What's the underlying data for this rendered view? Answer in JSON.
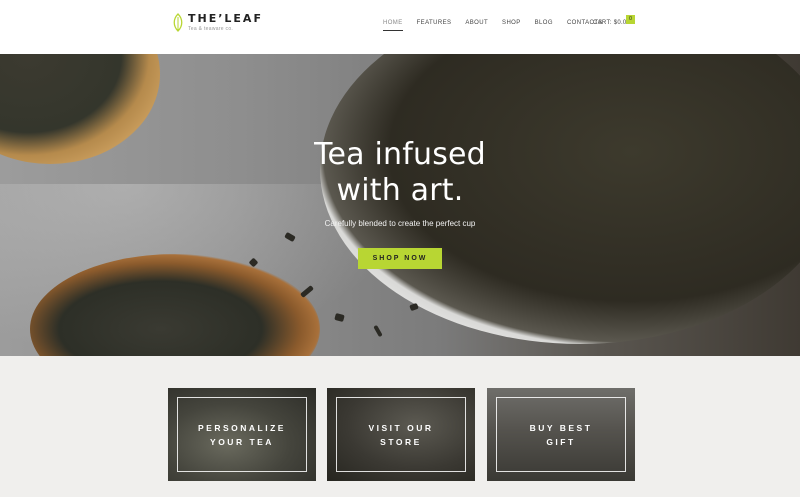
{
  "brand": {
    "name": "THE’LEAF",
    "tagline": "Tea & teaware co.",
    "icon": "leaf-icon",
    "accent": "#b8d633"
  },
  "nav": {
    "items": [
      {
        "label": "HOME",
        "active": true
      },
      {
        "label": "FEATURES",
        "active": false
      },
      {
        "label": "ABOUT",
        "active": false
      },
      {
        "label": "SHOP",
        "active": false
      },
      {
        "label": "BLOG",
        "active": false
      },
      {
        "label": "CONTACTS",
        "active": false
      }
    ],
    "cart_label": "CART: $0.00",
    "cart_count": "0"
  },
  "hero": {
    "title_line1": "Tea infused",
    "title_line2": "with art.",
    "subtitle": "Carefully blended to create the perfect cup",
    "button_label": "SHOP NOW"
  },
  "features": [
    {
      "line1": "PERSONALIZE",
      "line2": "YOUR TEA"
    },
    {
      "line1": "VISIT OUR",
      "line2": "STORE"
    },
    {
      "line1": "BUY BEST",
      "line2": "GIFT"
    }
  ]
}
